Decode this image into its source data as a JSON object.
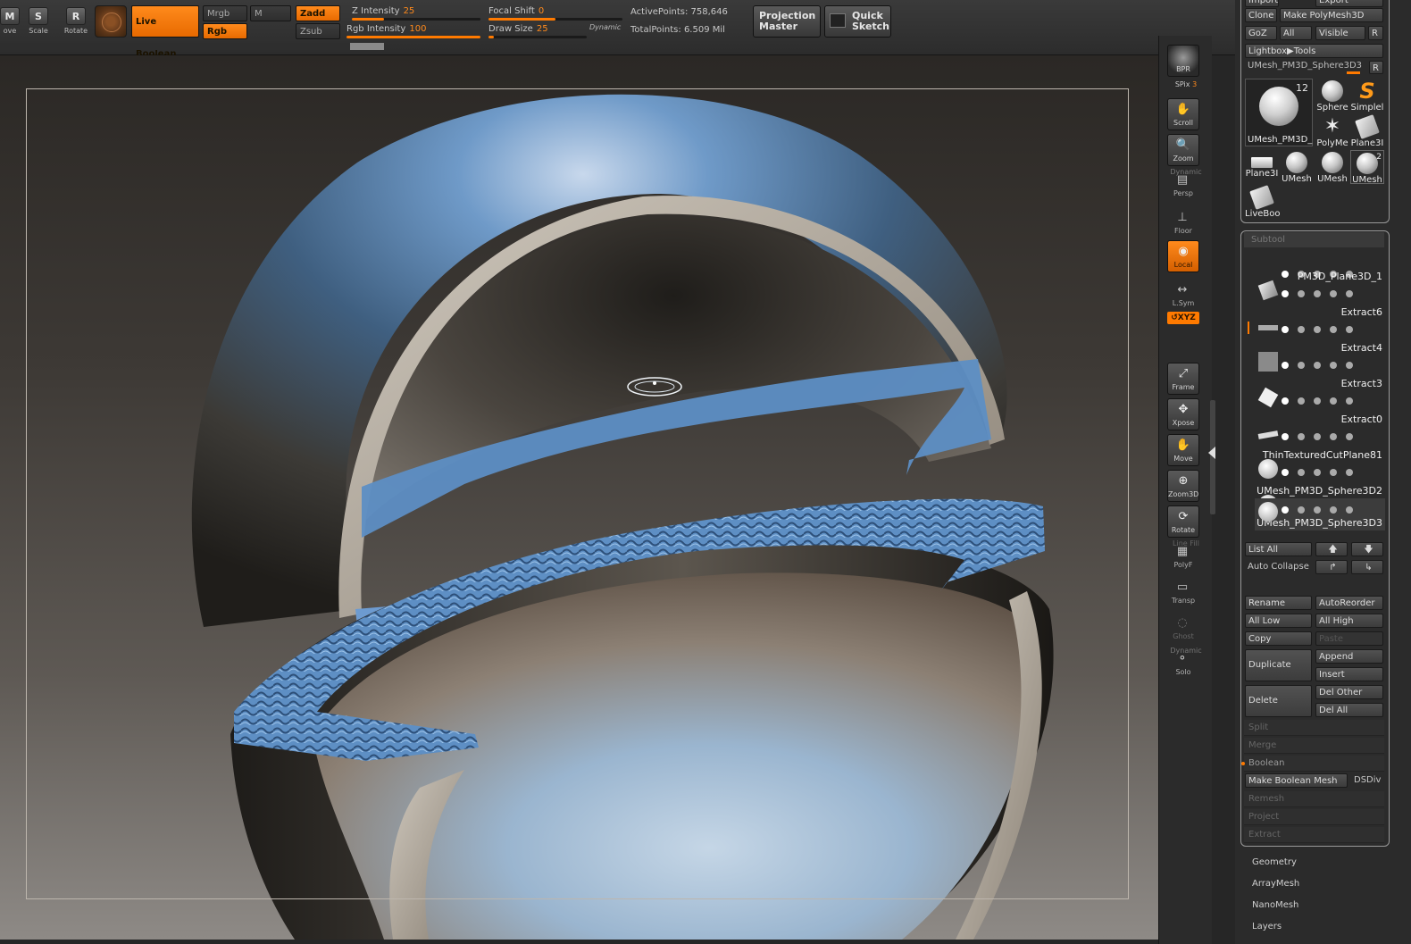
{
  "topbar": {
    "tools": [
      {
        "label": "ove",
        "glyph": "M"
      },
      {
        "label": "Scale",
        "glyph": "S"
      },
      {
        "label": "Rotate",
        "glyph": "R"
      }
    ],
    "live_boolean": "Live Boolean",
    "mrgb": "Mrgb",
    "m": "M",
    "rgb": "Rgb",
    "zadd": "Zadd",
    "zsub": "Zsub",
    "z_intensity": {
      "label": "Z Intensity",
      "value": "25",
      "fraction": 0.25
    },
    "rgb_intensity": {
      "label": "Rgb Intensity",
      "value": "100",
      "fraction": 1.0
    },
    "focal_shift": {
      "label": "Focal Shift",
      "value": "0",
      "fraction": 0.5
    },
    "draw_size": {
      "label": "Draw Size",
      "value": "25",
      "fraction": 0.05
    },
    "dynamic": "Dynamic",
    "active_points": "ActivePoints: 758,646",
    "total_points": "TotalPoints: 6.509 Mil",
    "projection_master": [
      "Projection",
      "Master"
    ],
    "quick_sketch": [
      "Quick",
      "Sketch"
    ]
  },
  "shelf": {
    "bpr": "BPR",
    "spix_label": "SPix",
    "spix_value": "3",
    "buttons": [
      "Scroll",
      "Zoom",
      "Persp",
      "Floor",
      "Local",
      "L.Sym",
      "Frame",
      "Xpose",
      "Move",
      "Zoom3D",
      "Rotate",
      "PolyF",
      "Transp",
      "Ghost",
      "Solo"
    ],
    "dynamic": "Dynamic",
    "xyz": "↺XYZ",
    "line_fill": "Line Fill"
  },
  "panel": {
    "import": "Import",
    "export": "Export",
    "clone": "Clone",
    "make_polymesh": "Make PolyMesh3D",
    "goz": "GoZ",
    "all": "All",
    "visible": "Visible",
    "r": "R",
    "lightbox_tools": "Lightbox▶Tools",
    "current_tool": "UMesh_PM3D_Sphere3D3",
    "current_tool_short": "UMesh_PM3D_",
    "current_count": "12",
    "tools": [
      {
        "label": "Sphere",
        "kind": "sphere"
      },
      {
        "label": "Simplel",
        "kind": "s"
      },
      {
        "label": "PolyMe",
        "kind": "star"
      },
      {
        "label": "Plane3I",
        "kind": "sq"
      },
      {
        "label": "Plane3I",
        "kind": "flat"
      },
      {
        "label": "UMesh",
        "kind": "sphere"
      },
      {
        "label": "UMesh",
        "kind": "sphere"
      },
      {
        "label": "UMesh",
        "kind": "sphere"
      },
      {
        "label": "LiveBoo",
        "kind": "sq"
      }
    ],
    "umesh_count": "2",
    "subtool_header": "Subtool",
    "subtools": [
      "PM3D_Plane3D_1",
      "Extract6",
      "Extract4",
      "Extract3",
      "Extract0",
      "ThinTexturedCutPlane81",
      "UMesh_PM3D_Sphere3D2",
      "UMesh_PM3D_Sphere3D3"
    ],
    "list_all": "List All",
    "auto_collapse": "Auto Collapse",
    "rename": "Rename",
    "autoreorder": "AutoReorder",
    "all_low": "All Low",
    "all_high": "All High",
    "copy": "Copy",
    "paste": "Paste",
    "duplicate": "Duplicate",
    "append": "Append",
    "insert": "Insert",
    "delete": "Delete",
    "del_other": "Del Other",
    "del_all": "Del All",
    "split": "Split",
    "merge": "Merge",
    "boolean": "Boolean",
    "make_boolean_mesh": "Make Boolean Mesh",
    "dsdiv": "DSDiv",
    "remesh": "Remesh",
    "project": "Project",
    "extract": "Extract",
    "menus": [
      "Geometry",
      "ArrayMesh",
      "NanoMesh",
      "Layers"
    ]
  },
  "colors": {
    "accent": "#ff7a00",
    "panel": "#2b2b2b",
    "shell_blue": "#5c8fc4"
  }
}
